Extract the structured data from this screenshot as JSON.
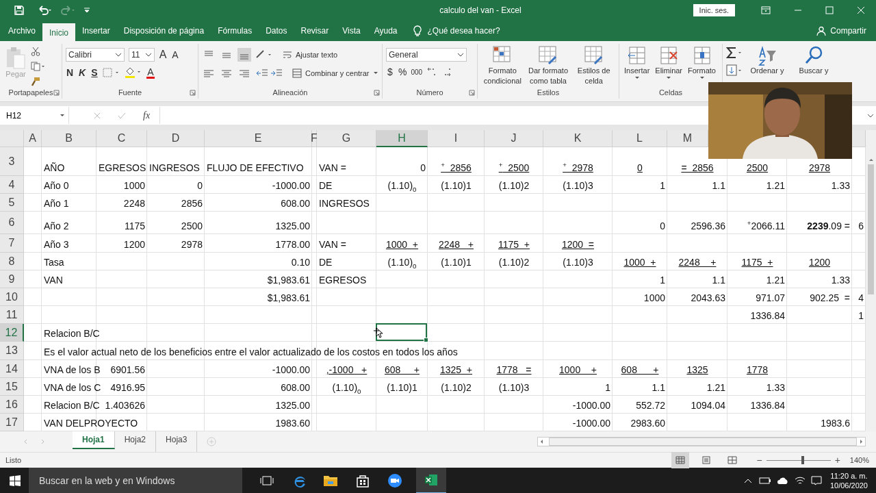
{
  "window": {
    "title": "calculo del van - Excel",
    "sign_in": "Inic. ses."
  },
  "quick_access": {
    "redo_disabled": true
  },
  "tabs": [
    {
      "label": "Archivo",
      "selected": false
    },
    {
      "label": "Inicio",
      "selected": true
    },
    {
      "label": "Insertar",
      "selected": false
    },
    {
      "label": "Disposición de página",
      "selected": false
    },
    {
      "label": "Fórmulas",
      "selected": false
    },
    {
      "label": "Datos",
      "selected": false
    },
    {
      "label": "Revisar",
      "selected": false
    },
    {
      "label": "Vista",
      "selected": false
    },
    {
      "label": "Ayuda",
      "selected": false
    }
  ],
  "tell_me": "¿Qué desea hacer?",
  "share": "Compartir",
  "ribbon": [
    {
      "kind": "clipboard",
      "label": "Portapapeles",
      "launcher": true,
      "paste": "Pegar",
      "paste_disabled": true
    },
    {
      "kind": "font",
      "label": "Fuente",
      "launcher": true,
      "font": "Calibri",
      "size": "11",
      "grow": "A",
      "shrink": "A",
      "bold": "N",
      "italic": "K",
      "underline": "S",
      "font_color": "A"
    },
    {
      "kind": "alignment",
      "label": "Alineación",
      "launcher": true,
      "wrap": "Ajustar texto",
      "merge": "Combinar y centrar"
    },
    {
      "kind": "number",
      "label": "Número",
      "launcher": true,
      "format": "General",
      "currency": "$",
      "percent": "%",
      "thousands": "000"
    },
    {
      "kind": "styles",
      "label": "Estilos",
      "launcher": false,
      "buttons": [
        "Formato condicional",
        "Dar formato como tabla",
        "Estilos de celda"
      ]
    },
    {
      "kind": "cells",
      "label": "Celdas",
      "launcher": false,
      "buttons": [
        "Insertar",
        "Eliminar",
        "Formato"
      ]
    },
    {
      "kind": "editing",
      "buttons": [
        "Ordenar y",
        "Buscar y"
      ]
    }
  ],
  "formula_bar": {
    "name_box": "H12",
    "function_label": "fx"
  },
  "columns": [
    {
      "label": "A",
      "selected": false
    },
    {
      "label": "B",
      "selected": false
    },
    {
      "label": "C",
      "selected": false
    },
    {
      "label": "D",
      "selected": false
    },
    {
      "label": "E",
      "selected": false
    },
    {
      "label": "F",
      "selected": false
    },
    {
      "label": "G",
      "selected": false
    },
    {
      "label": "H",
      "selected": true
    },
    {
      "label": "I",
      "selected": false
    },
    {
      "label": "J",
      "selected": false
    },
    {
      "label": "K",
      "selected": false
    },
    {
      "label": "L",
      "selected": false
    },
    {
      "label": "M",
      "selected": false
    }
  ],
  "rows": [
    {
      "row": "3",
      "selected": false,
      "cells": {
        "B": {
          "text": "AÑO",
          "underlined": false
        },
        "C": {
          "text": "EGRESOS",
          "underlined": false
        },
        "D": {
          "text": "INGRESOS",
          "underlined": false
        },
        "E": {
          "text": "FLUJO DE EFECTIVO",
          "underlined": false
        },
        "G": {
          "text": "VAN =",
          "underlined": false
        },
        "H": {
          "text": "0",
          "underlined": false
        },
        "I": {
          "text": "$^{+}$  2856",
          "underlined": true
        },
        "J": {
          "text": "$^{+}$  2500",
          "underlined": true
        },
        "K": {
          "text": "$^{+}$  2978",
          "underlined": true
        },
        "L": {
          "text": "0",
          "underlined": true
        },
        "M": {
          "text": "=  2856",
          "underlined": true
        },
        "N": {
          "text": "2500",
          "underlined": true
        },
        "O": {
          "text": "2978",
          "underlined": true
        }
      }
    },
    {
      "row": "4",
      "selected": false,
      "cells": {
        "B": {
          "text": "Año 0",
          "underlined": false
        },
        "C": {
          "text": "1000",
          "underlined": false
        },
        "D": {
          "text": "0",
          "underlined": false
        },
        "E": {
          "text": "-1000.00",
          "underlined": false
        },
        "G": {
          "text": "DE",
          "underlined": false
        },
        "H": {
          "text": "(1.10)$_{0}$",
          "underlined": false
        },
        "I": {
          "text": "(1.10)1",
          "underlined": false
        },
        "J": {
          "text": "(1.10)2",
          "underlined": false
        },
        "K": {
          "text": "(1.10)3",
          "underlined": false
        },
        "L": {
          "text": "1",
          "underlined": false
        },
        "M": {
          "text": "1.1",
          "underlined": false
        },
        "N": {
          "text": "1.21",
          "underlined": false
        },
        "O": {
          "text": "1.33",
          "underlined": false
        }
      }
    },
    {
      "row": "5",
      "selected": false,
      "cells": {
        "B": {
          "text": "Año 1",
          "underlined": false
        },
        "C": {
          "text": "2248",
          "underlined": false
        },
        "D": {
          "text": "2856",
          "underlined": false
        },
        "E": {
          "text": "608.00",
          "underlined": false
        },
        "G": {
          "text": "INGRESOS",
          "underlined": false
        }
      }
    },
    {
      "row": "6",
      "selected": false,
      "cells": {
        "B": {
          "text": "Año 2",
          "underlined": false
        },
        "C": {
          "text": "1175",
          "underlined": false
        },
        "D": {
          "text": "2500",
          "underlined": false
        },
        "E": {
          "text": "1325.00",
          "underlined": false
        },
        "L": {
          "text": "0",
          "underlined": false
        },
        "M": {
          "text": "2596.36",
          "underlined": false
        },
        "N": {
          "text": "$^{+}$2066.11",
          "underlined": false
        },
        "O": {
          "text": "**2239**.09 =",
          "underlined": false
        },
        "P": {
          "text": "6",
          "underlined": false
        }
      }
    },
    {
      "row": "7",
      "selected": false,
      "cells": {
        "B": {
          "text": "Año 3",
          "underlined": false
        },
        "C": {
          "text": "1200",
          "underlined": false
        },
        "D": {
          "text": "2978",
          "underlined": false
        },
        "E": {
          "text": "1778.00",
          "underlined": false
        },
        "G": {
          "text": "VAN =",
          "underlined": false
        },
        "H": {
          "text": "1000  +",
          "underlined": true
        },
        "I": {
          "text": "2248   +",
          "underlined": true
        },
        "J": {
          "text": "1175  +",
          "underlined": true
        },
        "K": {
          "text": "1200  =",
          "underlined": true
        }
      }
    },
    {
      "row": "8",
      "selected": false,
      "cells": {
        "B": {
          "text": "Tasa",
          "underlined": false
        },
        "E": {
          "text": "0.10",
          "underlined": false
        },
        "G": {
          "text": "DE",
          "underlined": false
        },
        "H": {
          "text": "(1.10)$_{0}$",
          "underlined": false
        },
        "I": {
          "text": "(1.10)1",
          "underlined": false
        },
        "J": {
          "text": "(1.10)2",
          "underlined": false
        },
        "K": {
          "text": "(1.10)3",
          "underlined": false
        },
        "L": {
          "text": "1000  +",
          "underlined": true
        },
        "M": {
          "text": "2248    +",
          "underlined": true
        },
        "N": {
          "text": "1175  +",
          "underlined": true
        },
        "O": {
          "text": "1200",
          "underlined": true
        }
      }
    },
    {
      "row": "9",
      "selected": false,
      "cells": {
        "B": {
          "text": "VAN",
          "underlined": false
        },
        "E": {
          "text": "$1,983.61",
          "underlined": false
        },
        "G": {
          "text": "EGRESOS",
          "underlined": false
        },
        "L": {
          "text": "1",
          "underlined": false
        },
        "M": {
          "text": "1.1",
          "underlined": false
        },
        "N": {
          "text": "1.21",
          "underlined": false
        },
        "O": {
          "text": "1.33",
          "underlined": false
        }
      }
    },
    {
      "row": "10",
      "selected": false,
      "cells": {
        "E": {
          "text": "$1,983.61",
          "underlined": false
        },
        "L": {
          "text": "1000",
          "underlined": false
        },
        "M": {
          "text": "2043.63",
          "underlined": false
        },
        "N": {
          "text": "971.07",
          "underlined": false
        },
        "O": {
          "text": "902.25  =",
          "underlined": false
        },
        "P": {
          "text": "4",
          "underlined": false
        }
      }
    },
    {
      "row": "11",
      "selected": false,
      "cells": {
        "N": {
          "text": "1336.84",
          "underlined": false
        },
        "P": {
          "text": "1",
          "underlined": false
        }
      }
    },
    {
      "row": "12",
      "selected": true,
      "cells": {
        "B": {
          "text": "Relacion B/C",
          "underlined": false
        }
      }
    },
    {
      "row": "13",
      "selected": false,
      "cells": {
        "B": {
          "text": "Es el valor actual neto de los beneficios entre el valor actualizado de los costos en todos los años",
          "underlined": false
        }
      }
    },
    {
      "row": "14",
      "selected": false,
      "cells": {
        "B": {
          "text": "VNA de los B",
          "underlined": false
        },
        "C": {
          "text": "6901.56",
          "underlined": false
        },
        "E": {
          "text": "-1000.00",
          "underlined": false
        },
        "G": {
          "text": ",-1000   +",
          "underlined": true
        },
        "H": {
          "text": "608     +",
          "underlined": true
        },
        "I": {
          "text": "1325  +",
          "underlined": true
        },
        "J": {
          "text": "1778   =",
          "underlined": true
        },
        "K": {
          "text": "1000    +",
          "underlined": true
        },
        "L": {
          "text": "608      +",
          "underlined": true
        },
        "M": {
          "text": "1325",
          "underlined": true
        },
        "N": {
          "text": "1778",
          "underlined": true
        }
      }
    },
    {
      "row": "15",
      "selected": false,
      "cells": {
        "B": {
          "text": "VNA de los C",
          "underlined": false
        },
        "C": {
          "text": "4916.95",
          "underlined": false
        },
        "E": {
          "text": "608.00",
          "underlined": false
        },
        "G": {
          "text": "(1.10)$_{0}$",
          "underlined": false
        },
        "H": {
          "text": "(1.10)1",
          "underlined": false
        },
        "I": {
          "text": "(1.10)2",
          "underlined": false
        },
        "J": {
          "text": "(1.10)3",
          "underlined": false
        },
        "K": {
          "text": "1",
          "underlined": false
        },
        "L": {
          "text": "1.1",
          "underlined": false
        },
        "M": {
          "text": "1.21",
          "underlined": false
        },
        "N": {
          "text": "1.33",
          "underlined": false
        }
      }
    },
    {
      "row": "16",
      "selected": false,
      "cells": {
        "B": {
          "text": "Relacion B/C",
          "underlined": false
        },
        "C": {
          "text": "1.403626",
          "underlined": false
        },
        "E": {
          "text": "1325.00",
          "underlined": false
        },
        "K": {
          "text": "-1000.00",
          "underlined": false
        },
        "L": {
          "text": "552.72",
          "underlined": false
        },
        "M": {
          "text": "1094.04",
          "underlined": false
        },
        "N": {
          "text": "1336.84",
          "underlined": false
        }
      }
    },
    {
      "row": "17",
      "selected": false,
      "cells": {
        "B": {
          "text": "VAN DELPROYECTO",
          "underlined": false
        },
        "E": {
          "text": "1983.60",
          "underlined": false
        },
        "K": {
          "text": "-1000.00",
          "underlined": false
        },
        "L": {
          "text": "2983.60",
          "underlined": false
        },
        "O": {
          "text": "1983.6",
          "underlined": false
        }
      }
    }
  ],
  "sheets": [
    {
      "label": "Hoja1",
      "selected": true
    },
    {
      "label": "Hoja2",
      "selected": false
    },
    {
      "label": "Hoja3",
      "selected": false
    }
  ],
  "status_bar": {
    "text": "Listo",
    "zoom_out": "−",
    "zoom_in": "+",
    "zoom": "140%",
    "zoom_slider": {
      "level": 0.57
    }
  },
  "taskbar": {
    "search_placeholder": "Buscar en la web y en Windows",
    "time": "11:20 a. m.",
    "date": "10/06/2020"
  }
}
